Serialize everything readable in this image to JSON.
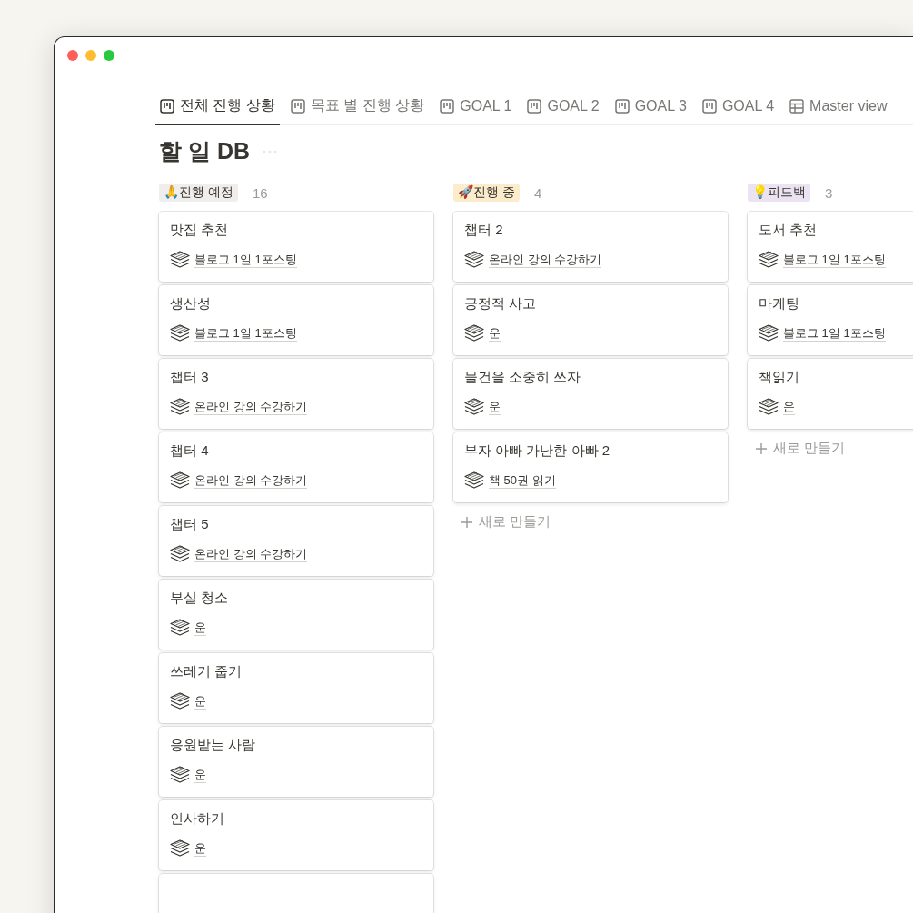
{
  "tabs": [
    {
      "label": "전체 진행 상황",
      "kind": "board",
      "selected": true
    },
    {
      "label": "목표 별 진행 상황",
      "kind": "board",
      "selected": false
    },
    {
      "label": "GOAL 1",
      "kind": "board",
      "selected": false
    },
    {
      "label": "GOAL 2",
      "kind": "board",
      "selected": false
    },
    {
      "label": "GOAL 3",
      "kind": "board",
      "selected": false
    },
    {
      "label": "GOAL 4",
      "kind": "board",
      "selected": false
    },
    {
      "label": "Master view",
      "kind": "table",
      "selected": false
    }
  ],
  "title": "할 일 DB",
  "columns": [
    {
      "label": "🙏진행 예정",
      "color": "#efeeec",
      "count": "16",
      "cards": [
        {
          "title": "맛집 추천",
          "relation": "블로그 1일 1포스팅"
        },
        {
          "title": "생산성",
          "relation": "블로그 1일 1포스팅"
        },
        {
          "title": "챕터 3",
          "relation": "온라인 강의 수강하기"
        },
        {
          "title": "챕터 4",
          "relation": "온라인 강의 수강하기"
        },
        {
          "title": "챕터 5",
          "relation": "온라인 강의 수강하기"
        },
        {
          "title": "부실 청소",
          "relation": "운"
        },
        {
          "title": "쓰레기 줍기",
          "relation": "운"
        },
        {
          "title": "응원받는 사람",
          "relation": "운"
        },
        {
          "title": "인사하기",
          "relation": "운"
        },
        {
          "kind": "cut"
        }
      ]
    },
    {
      "label": "🚀진행 중",
      "color": "#fbeccc",
      "count": "4",
      "new_label": "새로 만들기",
      "cards": [
        {
          "title": "챕터 2",
          "relation": "온라인 강의 수강하기"
        },
        {
          "title": "긍정적 사고",
          "relation": "운"
        },
        {
          "title": "물건을 소중히 쓰자",
          "relation": "운"
        },
        {
          "title": "부자 아빠 가난한 아빠 2",
          "relation": "책 50권 읽기"
        }
      ]
    },
    {
      "label": "💡피드백",
      "color": "#ebe3f2",
      "count": "3",
      "new_label": "새로 만들기",
      "cards": [
        {
          "title": "도서 추천",
          "relation": "블로그 1일 1포스팅"
        },
        {
          "title": "마케팅",
          "relation": "블로그 1일 1포스팅"
        },
        {
          "title": "책읽기",
          "relation": "운"
        }
      ]
    }
  ]
}
